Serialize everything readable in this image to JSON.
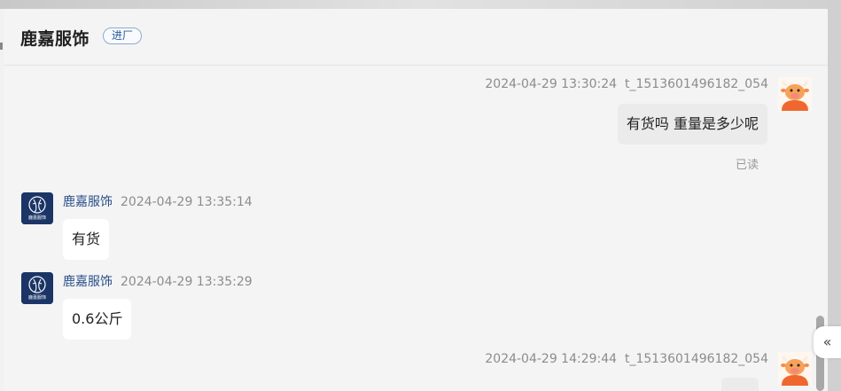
{
  "header": {
    "shop_name": "鹿嘉服饰",
    "shop_tag": "进厂"
  },
  "messages": [
    {
      "direction": "outgoing",
      "timestamp": "2024-04-29 13:30:24",
      "sender": "t_1513601496182_054",
      "text": "有货吗 重量是多少呢",
      "read_status": "已读",
      "avatar_icon": "cartoon-cow-avatar-icon"
    },
    {
      "direction": "incoming",
      "sender": "鹿嘉服饰",
      "timestamp": "2024-04-29 13:35:14",
      "text": "有货",
      "avatar_icon": "deer-logo-avatar-icon",
      "avatar_caption": "鹿嘉服饰"
    },
    {
      "direction": "incoming",
      "sender": "鹿嘉服饰",
      "timestamp": "2024-04-29 13:35:29",
      "text": "0.6公斤",
      "avatar_icon": "deer-logo-avatar-icon",
      "avatar_caption": "鹿嘉服饰"
    },
    {
      "direction": "outgoing",
      "timestamp": "2024-04-29 14:29:44",
      "sender": "t_1513601496182_054",
      "text": "",
      "avatar_icon": "cartoon-cow-avatar-icon"
    }
  ],
  "controls": {
    "collapse_glyph": "«",
    "collapse_icon": "double-chevron-left-icon"
  },
  "colors": {
    "incoming_name": "#2a4f8a",
    "tag_border": "#8fa9cc",
    "outgoing_bubble": "#ebebeb",
    "incoming_bubble": "#ffffff",
    "background": "#f4f4f4"
  }
}
